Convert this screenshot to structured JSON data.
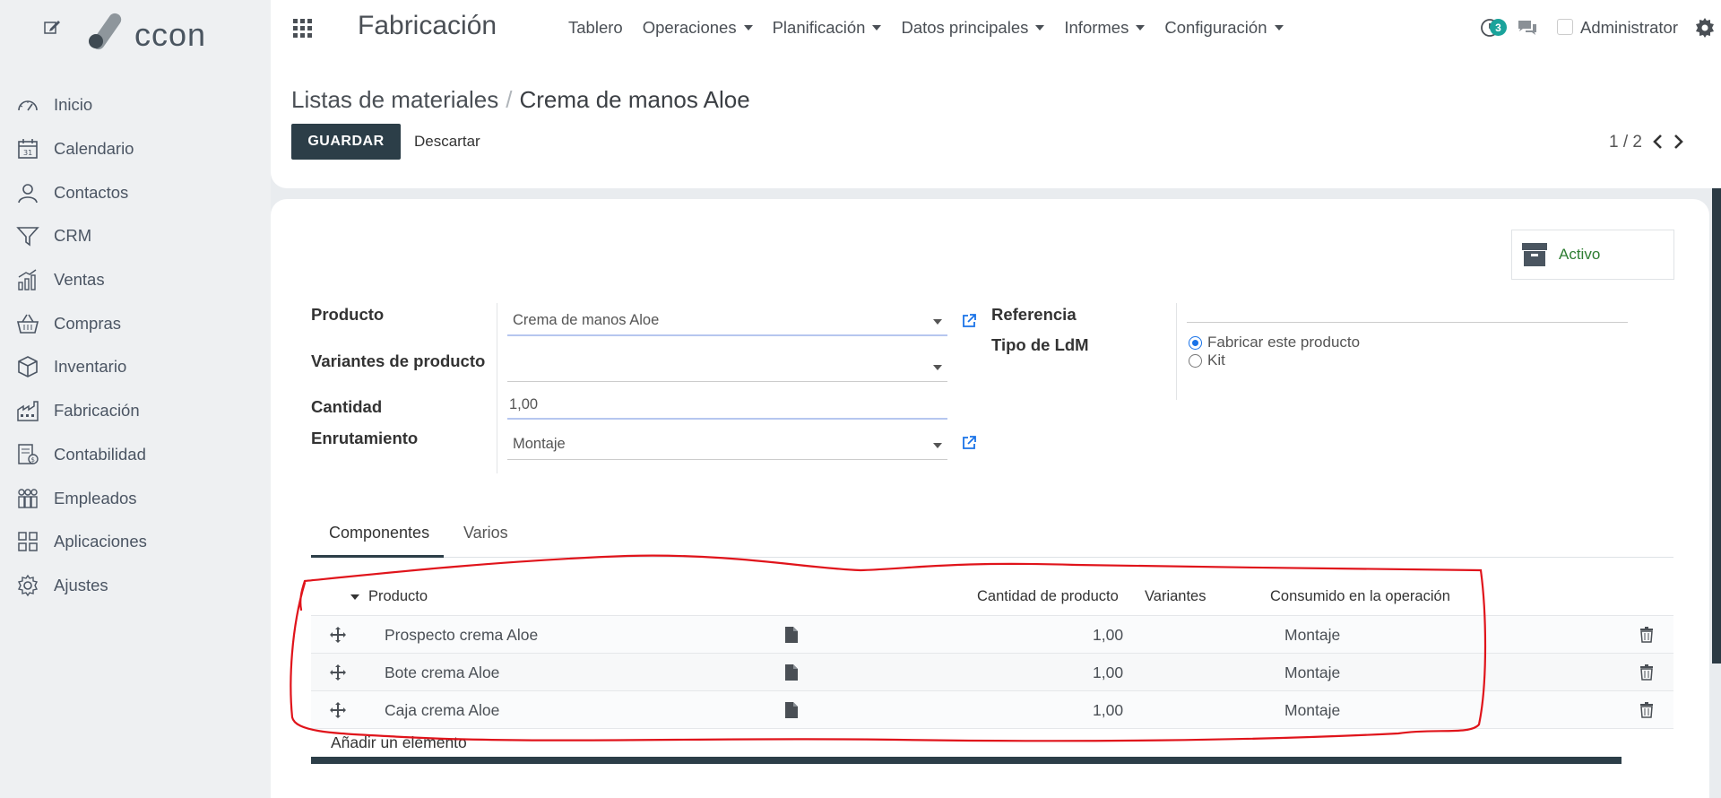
{
  "brand": {
    "logo_text": "ccon"
  },
  "sidebar": {
    "items": [
      {
        "label": "Inicio",
        "icon": "dashboard-icon"
      },
      {
        "label": "Calendario",
        "icon": "calendar-icon"
      },
      {
        "label": "Contactos",
        "icon": "user-icon"
      },
      {
        "label": "CRM",
        "icon": "funnel-icon"
      },
      {
        "label": "Ventas",
        "icon": "bar-chart-icon"
      },
      {
        "label": "Compras",
        "icon": "basket-icon"
      },
      {
        "label": "Inventario",
        "icon": "box-icon"
      },
      {
        "label": "Fabricación",
        "icon": "factory-icon"
      },
      {
        "label": "Contabilidad",
        "icon": "accounting-icon"
      },
      {
        "label": "Empleados",
        "icon": "team-icon"
      },
      {
        "label": "Aplicaciones",
        "icon": "apps-grid-icon"
      },
      {
        "label": "Ajustes",
        "icon": "gear-icon"
      }
    ]
  },
  "topbar": {
    "app_title": "Fabricación",
    "menu": [
      {
        "label": "Tablero",
        "dropdown": false
      },
      {
        "label": "Operaciones",
        "dropdown": true
      },
      {
        "label": "Planificación",
        "dropdown": true
      },
      {
        "label": "Datos principales",
        "dropdown": true
      },
      {
        "label": "Informes",
        "dropdown": true
      },
      {
        "label": "Configuración",
        "dropdown": true
      }
    ],
    "activity_count": "3",
    "user_name": "Administrator"
  },
  "control": {
    "breadcrumb_parent": "Listas de materiales",
    "breadcrumb_sep": "/",
    "breadcrumb_current": "Crema de manos Aloe",
    "save_label": "GUARDAR",
    "discard_label": "Descartar",
    "pager": "1 / 2"
  },
  "form": {
    "active_label": "Activo",
    "producto_label": "Producto",
    "producto_value": "Crema de manos Aloe",
    "variantes_label": "Variantes de producto",
    "variantes_value": "",
    "cantidad_label": "Cantidad",
    "cantidad_value": "1,00",
    "enrutamiento_label": "Enrutamiento",
    "enrutamiento_value": "Montaje",
    "referencia_label": "Referencia",
    "referencia_value": "",
    "tipo_label": "Tipo de LdM",
    "tipo_options": [
      {
        "label": "Fabricar este producto",
        "selected": true
      },
      {
        "label": "Kit",
        "selected": false
      }
    ]
  },
  "tabs": [
    {
      "label": "Componentes",
      "active": true
    },
    {
      "label": "Varios",
      "active": false
    }
  ],
  "table": {
    "columns": {
      "producto": "Producto",
      "cantidad": "Cantidad de producto",
      "variantes": "Variantes",
      "consumido": "Consumido en la operación"
    },
    "rows": [
      {
        "producto": "Prospecto crema Aloe",
        "cantidad": "1,00",
        "consumido": "Montaje"
      },
      {
        "producto": "Bote crema Aloe",
        "cantidad": "1,00",
        "consumido": "Montaje"
      },
      {
        "producto": "Caja crema Aloe",
        "cantidad": "1,00",
        "consumido": "Montaje"
      }
    ],
    "add_line": "Añadir un elemento"
  },
  "colors": {
    "primary": "#2c3e48",
    "active_green": "#2e7d32",
    "annotation_red": "#e0141b",
    "badge": "#1aa39b",
    "link_blue": "#1a73e8"
  }
}
